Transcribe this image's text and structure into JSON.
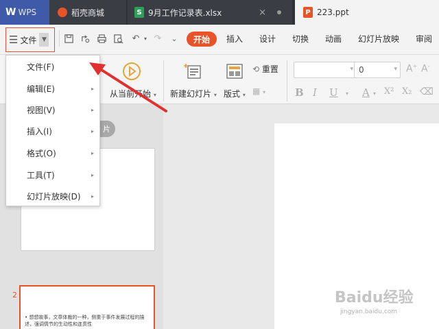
{
  "titlebar": {
    "tabs": [
      {
        "label": "WPS",
        "logo": "W"
      },
      {
        "label": "稻壳商城",
        "icon": "flame-icon"
      },
      {
        "label": "9月工作记录表.xlsx",
        "icon": "S",
        "close": "×"
      },
      {
        "label": "223.ppt",
        "icon": "P"
      }
    ]
  },
  "menubar": {
    "file_label": "文件",
    "ribbon_tabs": [
      "开始",
      "插入",
      "设计",
      "切换",
      "动画",
      "幻灯片放映",
      "审阅"
    ]
  },
  "ribbon": {
    "from_current": "从当前开始",
    "new_slide": "新建幻灯片",
    "layout": "版式",
    "reset": "重置",
    "font_size": "0",
    "format_buttons": [
      "B",
      "I",
      "U",
      "A",
      "X²",
      "X₂"
    ]
  },
  "panel": {
    "slides_tab": "片",
    "thumb2_number": "2",
    "thumb2_text": "• 想想故事，文章体裁的一种，侧重于事件发展过程的描述，强调情节的生动性和连贯性"
  },
  "file_menu": {
    "items": [
      {
        "label": "文件(F)",
        "submenu": false
      },
      {
        "label": "编辑(E)",
        "submenu": true
      },
      {
        "label": "视图(V)",
        "submenu": true
      },
      {
        "label": "插入(I)",
        "submenu": true
      },
      {
        "label": "格式(O)",
        "submenu": true
      },
      {
        "label": "工具(T)",
        "submenu": true
      },
      {
        "label": "幻灯片放映(D)",
        "submenu": true
      }
    ],
    "submenu_glyph": "▸"
  },
  "watermark": {
    "brand": "Baidu经验",
    "url": "jingyan.baidu.com"
  },
  "colors": {
    "accent": "#e8542a",
    "titlebar": "#2f3238",
    "annotation": "#e03030"
  }
}
